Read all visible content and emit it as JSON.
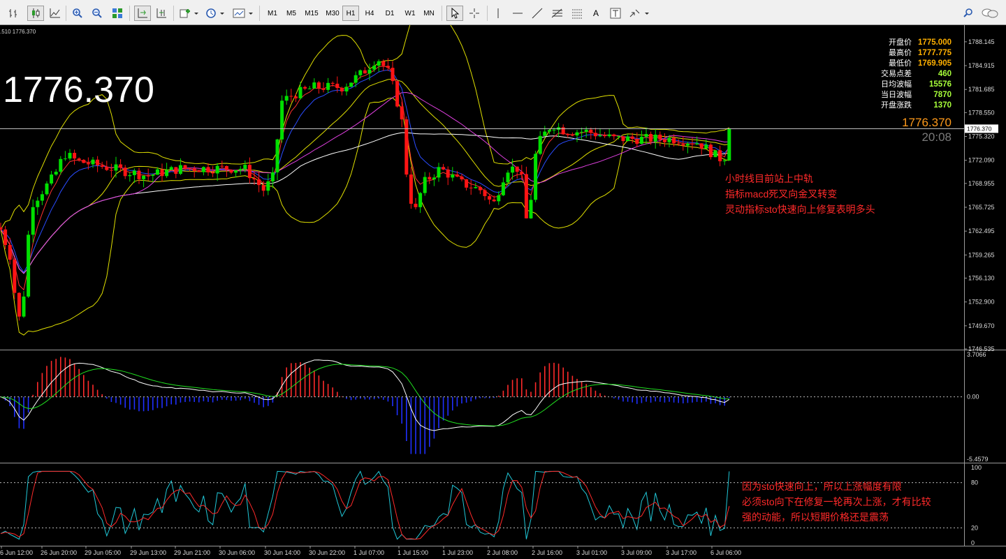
{
  "toolbar": {
    "timeframes": [
      "M1",
      "M5",
      "M15",
      "M30",
      "H1",
      "H4",
      "D1",
      "W1",
      "MN"
    ],
    "active_timeframe": "H1",
    "text_tool_label": "A",
    "icons": [
      "bar-chart-icon",
      "candles-icon",
      "line-chart-icon",
      "zoom-in-icon",
      "zoom-out-icon",
      "tile-windows-icon",
      "autoscroll-icon",
      "chart-shift-icon",
      "new-indicator-icon",
      "periods-icon",
      "templates-icon",
      "cursor-icon",
      "crosshair-icon",
      "vertical-line-icon",
      "horizontal-line-icon",
      "trendline-icon",
      "fibonacci-icon",
      "text-icon",
      "text-label-icon",
      "arrows-icon",
      "search-icon",
      "chat-icon"
    ]
  },
  "chart": {
    "corner_label": ".510 1776.370",
    "big_price": "1776.370",
    "current_price": "1776.370",
    "price_box": "1776.370",
    "countdown": "20:08",
    "price_axis_ticks": [
      "1788.145",
      "1784.915",
      "1781.685",
      "1778.550",
      "1775.320",
      "1772.090",
      "1768.955",
      "1765.725",
      "1762.495",
      "1759.265",
      "1756.130",
      "1752.900",
      "1749.670",
      "1746.535"
    ],
    "info_panel": [
      {
        "label": "开盘价",
        "value": "1775.000"
      },
      {
        "label": "最高价",
        "value": "1777.775"
      },
      {
        "label": "最低价",
        "value": "1769.905"
      },
      {
        "label": "交易点差",
        "value": "460"
      },
      {
        "label": "日均波幅",
        "value": "15576"
      },
      {
        "label": "当日波幅",
        "value": "7870"
      },
      {
        "label": "开盘涨跌",
        "value": "1370"
      }
    ],
    "annotation_main": [
      "小时线目前站上中轨",
      "指标macd死叉向金叉转变",
      "灵动指标sto快速向上修复表明多头"
    ],
    "macd_ticks": [
      "3.7066",
      "0.00",
      "-5.4579"
    ],
    "stoch_ticks": [
      "100",
      "80",
      "20",
      "0"
    ],
    "annotation_stoch": [
      "因为sto快速向上，所以上涨幅度有限",
      "必须sto向下在修复一轮再次上涨，才有比较",
      "强的动能，所以短期价格还是震荡"
    ],
    "time_labels": [
      "6 Jun 12:00",
      "26 Jun 20:00",
      "29 Jun 05:00",
      "29 Jun 13:00",
      "29 Jun 21:00",
      "30 Jun 06:00",
      "30 Jun 14:00",
      "30 Jun 22:00",
      "1 Jul 07:00",
      "1 Jul 15:00",
      "1 Jul 23:00",
      "2 Jul 08:00",
      "2 Jul 16:00",
      "3 Jul 01:00",
      "3 Jul 09:00",
      "3 Jul 17:00",
      "6 Jul 06:00"
    ],
    "colors": {
      "bull": "#00e000",
      "bear": "#ff1414",
      "price": "#ff9a1a",
      "annotation": "#ff2a2a",
      "info_value": "#ffb000",
      "info_value_green": "#a8ff3a"
    }
  },
  "chart_data": {
    "type": "line",
    "title": "",
    "y_range": [
      1746.535,
      1790.4
    ],
    "key_points": [
      {
        "x": "6 Jun 12:00",
        "close": 1762.5
      },
      {
        "x": "26 Jun 20:00",
        "close": 1772.0
      },
      {
        "x": "30 Jun 14:00",
        "close": 1781.5
      },
      {
        "x": "1 Jul 07:00",
        "close": 1784.5
      },
      {
        "x": "1 Jul 15:00",
        "close": 1767.0
      },
      {
        "x": "2 Jul 16:00",
        "close": 1775.5
      },
      {
        "x": "6 Jul 06:00",
        "close": 1776.37
      }
    ],
    "macd_range": [
      -5.4579,
      3.7066
    ],
    "stoch_range": [
      0,
      100
    ]
  }
}
